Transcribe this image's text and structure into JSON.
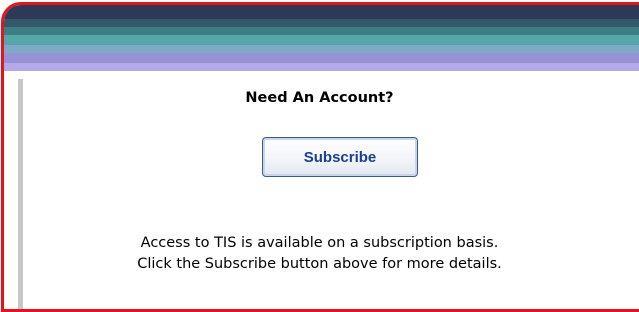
{
  "panel": {
    "heading": "Need An Account?",
    "subscribe_label": "Subscribe",
    "info_lines": [
      "Access to TIS is available on a subscription basis.",
      "Click the Subscribe button above for more details."
    ]
  },
  "colors": {
    "frame_border": "#e8121a",
    "button_text": "#1b3f8f",
    "header_top": "#2c3a55",
    "header_bottom": "#b4a8e8"
  }
}
